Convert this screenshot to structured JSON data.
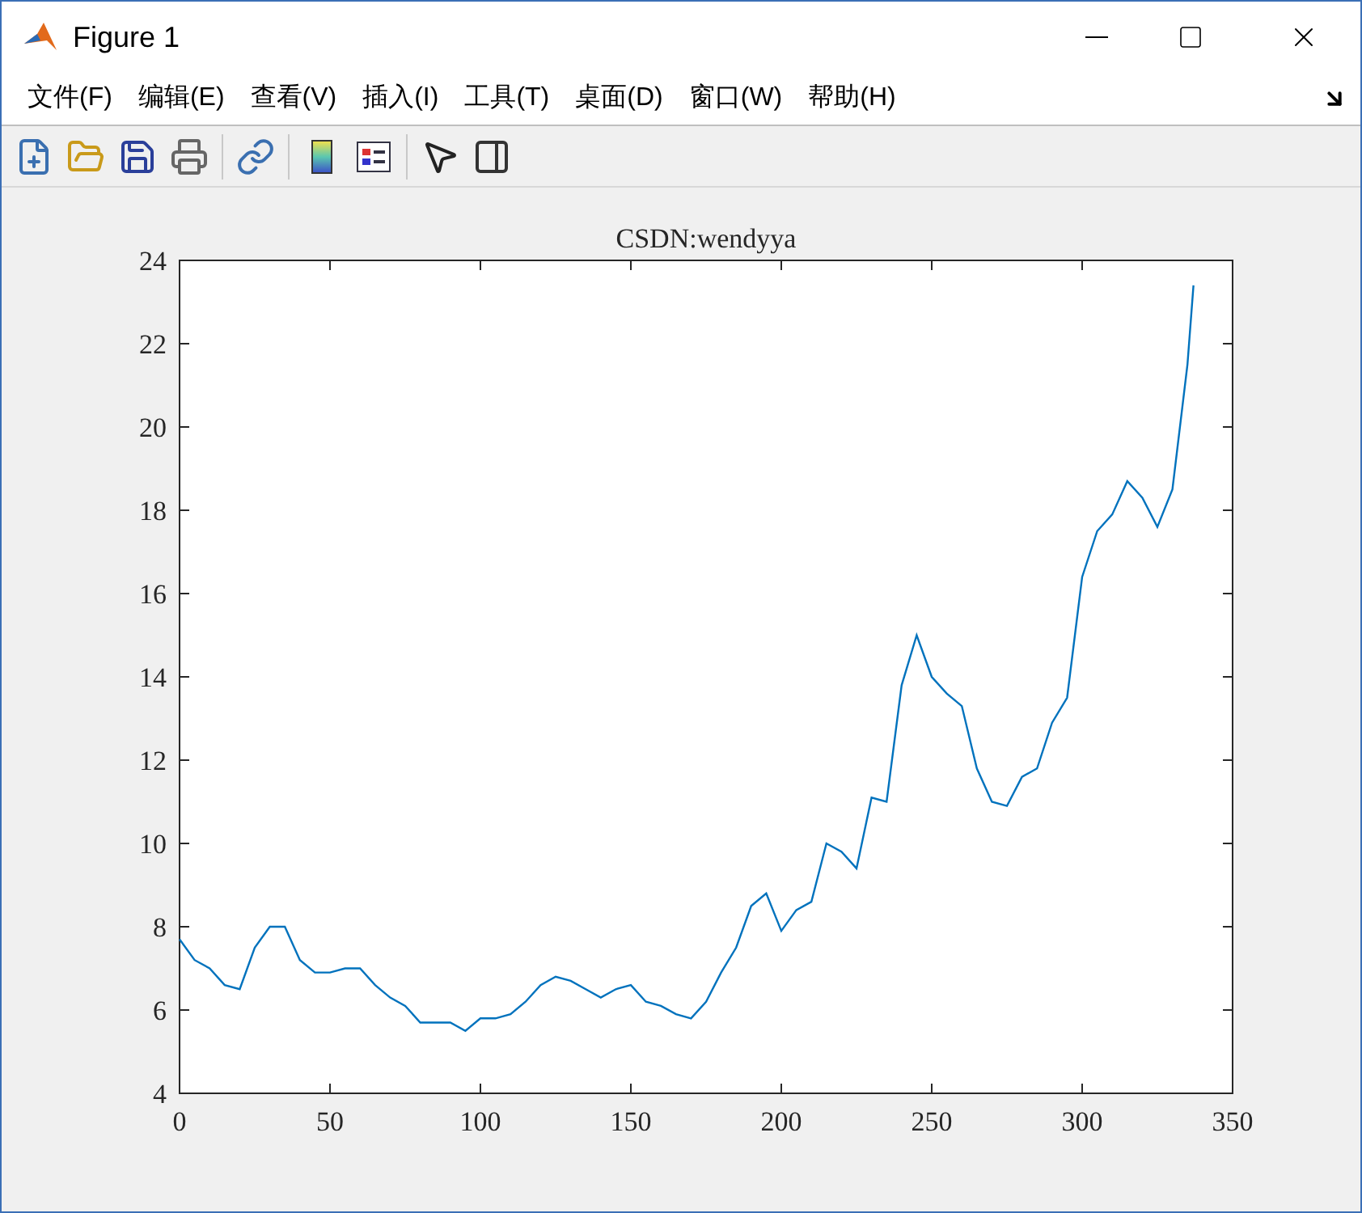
{
  "window": {
    "title": "Figure 1"
  },
  "menu": [
    "文件(F)",
    "编辑(E)",
    "查看(V)",
    "插入(I)",
    "工具(T)",
    "桌面(D)",
    "窗口(W)",
    "帮助(H)"
  ],
  "toolbar": [
    {
      "kind": "new"
    },
    {
      "kind": "open"
    },
    {
      "kind": "save"
    },
    {
      "kind": "print"
    },
    {
      "kind": "sep"
    },
    {
      "kind": "link"
    },
    {
      "kind": "sep"
    },
    {
      "kind": "colorbar"
    },
    {
      "kind": "legend"
    },
    {
      "kind": "sep"
    },
    {
      "kind": "pointer"
    },
    {
      "kind": "panel"
    }
  ],
  "chart_data": {
    "type": "line",
    "title": "CSDN:wendyya",
    "xlim": [
      0,
      350
    ],
    "ylim": [
      4,
      24
    ],
    "xticks": [
      0,
      50,
      100,
      150,
      200,
      250,
      300,
      350
    ],
    "yticks": [
      4,
      6,
      8,
      10,
      12,
      14,
      16,
      18,
      20,
      22,
      24
    ],
    "x": [
      0,
      5,
      10,
      15,
      20,
      25,
      30,
      35,
      40,
      45,
      50,
      55,
      60,
      65,
      70,
      75,
      80,
      85,
      90,
      95,
      100,
      105,
      110,
      115,
      120,
      125,
      130,
      135,
      140,
      145,
      150,
      155,
      160,
      165,
      170,
      175,
      180,
      185,
      190,
      195,
      200,
      205,
      210,
      215,
      220,
      225,
      230,
      235,
      240,
      245,
      250,
      255,
      260,
      265,
      270,
      275,
      280,
      285,
      290,
      295,
      300,
      305,
      310,
      315,
      320,
      325,
      330,
      335,
      337
    ],
    "values": [
      7.7,
      7.2,
      7.0,
      6.6,
      6.5,
      7.5,
      8.0,
      8.0,
      7.2,
      6.9,
      6.9,
      7.0,
      7.0,
      6.6,
      6.3,
      6.1,
      5.7,
      5.7,
      5.7,
      5.5,
      5.8,
      5.8,
      5.9,
      6.2,
      6.6,
      6.8,
      6.7,
      6.5,
      6.3,
      6.5,
      6.6,
      6.2,
      6.1,
      5.9,
      5.8,
      6.2,
      6.9,
      7.5,
      8.5,
      8.8,
      7.9,
      8.4,
      8.6,
      10.0,
      9.8,
      9.4,
      11.1,
      11.0,
      13.8,
      15.0,
      14.0,
      13.6,
      13.3,
      11.8,
      11.0,
      10.9,
      11.6,
      11.8,
      12.9,
      13.5,
      16.4,
      17.5,
      17.9,
      18.7,
      18.3,
      17.6,
      18.5,
      21.5,
      23.4
    ]
  }
}
